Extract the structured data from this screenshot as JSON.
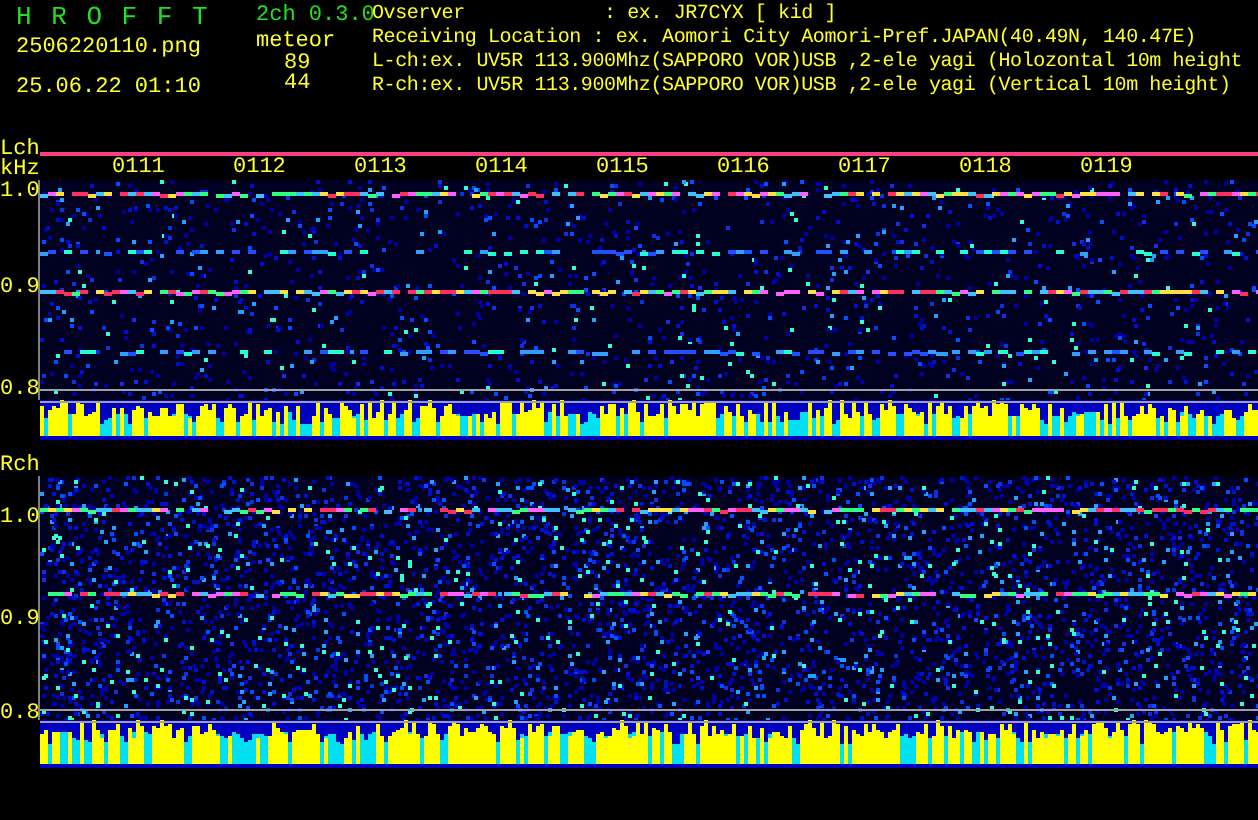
{
  "header": {
    "app_title": "H R O F F T",
    "version": "2ch 0.3.0",
    "filename": "2506220110.png",
    "datetime": "25.06.22 01:10",
    "meteor_label": "meteor",
    "meteor_counts": [
      "89",
      "44"
    ],
    "info_lines": [
      "Ovserver            : ex. JR7CYX [ kid ]",
      "Receiving Location : ex. Aomori City Aomori-Pref.JAPAN(40.49N, 140.47E)",
      "L-ch:ex. UV5R 113.900Mhz(SAPPORO VOR)USB ,2-ele yagi (Holozontal 10m height",
      "R-ch:ex. UV5R 113.900Mhz(SAPPORO VOR)USB ,2-ele yagi (Vertical 10m height)"
    ]
  },
  "channels": [
    {
      "label": "Lch",
      "unit": "kHz",
      "time_labels": [
        "0111",
        "0112",
        "0113",
        "0114",
        "0115",
        "0116",
        "0117",
        "0118",
        "0119"
      ],
      "freq_labels": [
        "1.0",
        "0.9",
        "0.8"
      ]
    },
    {
      "label": "Rch",
      "freq_labels": [
        "1.0",
        "0.9",
        "0.8"
      ]
    }
  ]
}
